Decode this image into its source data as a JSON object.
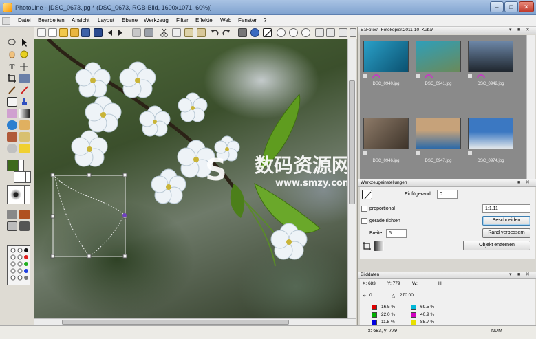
{
  "window": {
    "title": "PhotoLine - [DSC_0673.jpg * (DSC_0673, RGB-Bild, 1600x1071, 60%)]",
    "minimize": "–",
    "maximize": "□",
    "close": "✕"
  },
  "menu": [
    "Datei",
    "Bearbeiten",
    "Ansicht",
    "Layout",
    "Ebene",
    "Werkzeug",
    "Filter",
    "Effekte",
    "Web",
    "Fenster",
    "?"
  ],
  "browser": {
    "header": "E:\\Fotos\\_Fotokopier.2011-10_Kuba\\",
    "thumbnails": [
      {
        "name": "DSC_0940.jpg",
        "color_a": "#2aa0c8",
        "color_b": "#0b5170"
      },
      {
        "name": "DSC_0941.jpg",
        "color_a": "#2f9fb9",
        "color_b": "#6a8a5a"
      },
      {
        "name": "DSC_0942.jpg",
        "color_a": "#6c86a6",
        "color_b": "#20272f"
      },
      {
        "name": "DSC_0946.jpg",
        "color_a": "#8d7a68",
        "color_b": "#3e342a"
      },
      {
        "name": "DSC_0947.jpg",
        "color_a": "#c6a27a",
        "color_b": "#2d6aa8"
      },
      {
        "name": "DSC_0974.jpg",
        "color_a": "#3b78c2",
        "color_b": "#e1e6ea"
      }
    ]
  },
  "crop_panel": {
    "header": "Werkzeugeinstellungen",
    "einfuegerand_label": "Einfügerand:",
    "einfuegerand_value": "0",
    "proportional_label": "proportional",
    "proportional_value": "1:1.11",
    "gerade_label": "gerade richten",
    "breite_label": "Breite:",
    "breite_value": "5",
    "beschneiden_button": "Beschneiden",
    "rand_button": "Rand verbessern",
    "objekt_button": "Objekt entfernen"
  },
  "info_panel": {
    "header": "Bilddaten",
    "x_label": "X: 683",
    "y_label": "Y: 779",
    "w_label": "W:",
    "h_label": "H:",
    "dx_label": "0",
    "angle_label": "270.00",
    "rgb_values": [
      "16.5 %",
      "22.0 %",
      "11.8 %"
    ],
    "cmyk_values": [
      "69.5 %",
      "40.9 %",
      "85.7 %"
    ],
    "rgb_colors": [
      "#e00000",
      "#00b000",
      "#0000e0"
    ],
    "cmyk_colors": [
      "#00b8d8",
      "#d000c0",
      "#e8e000"
    ]
  },
  "status": {
    "coords": "x: 683, y: 779",
    "mode": "NUM"
  },
  "watermark": {
    "line1": "数码资源网",
    "line2": "www.smzy.com"
  },
  "colors": {
    "foreground": "#3e6a1c",
    "background": "#ffffff",
    "accent": "#3c7fb1"
  }
}
